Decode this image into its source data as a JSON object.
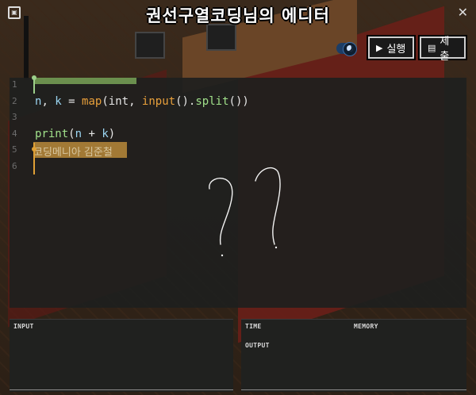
{
  "header": {
    "title": "권선구열코딩님의 에디터",
    "close_glyph": "✕",
    "corner_glyph": "▣"
  },
  "toolbar": {
    "run_label": "실행",
    "submit_label": "제출",
    "run_icon": "play-icon",
    "submit_icon": "document-icon"
  },
  "editor": {
    "lines": [
      {
        "num": "1"
      },
      {
        "num": "2"
      },
      {
        "num": "3"
      },
      {
        "num": "4"
      },
      {
        "num": "5"
      },
      {
        "num": "6"
      }
    ],
    "line2": {
      "a": "n",
      "b": ", ",
      "c": "k",
      "d": " = ",
      "e": "map",
      "f": "(",
      "g": "int",
      "h": ", ",
      "i": "input",
      "j": "().",
      "k": "split",
      "l": "())"
    },
    "line4": {
      "a": "print",
      "b": "(",
      "c": "n",
      "d": " + ",
      "e": "k",
      "f": ")"
    },
    "line6_text": "코딩메니아 김준철"
  },
  "input_panel": {
    "label": "INPUT"
  },
  "output_panel": {
    "time_label": "TIME",
    "memory_label": "MEMORY",
    "output_label": "OUTPUT"
  }
}
